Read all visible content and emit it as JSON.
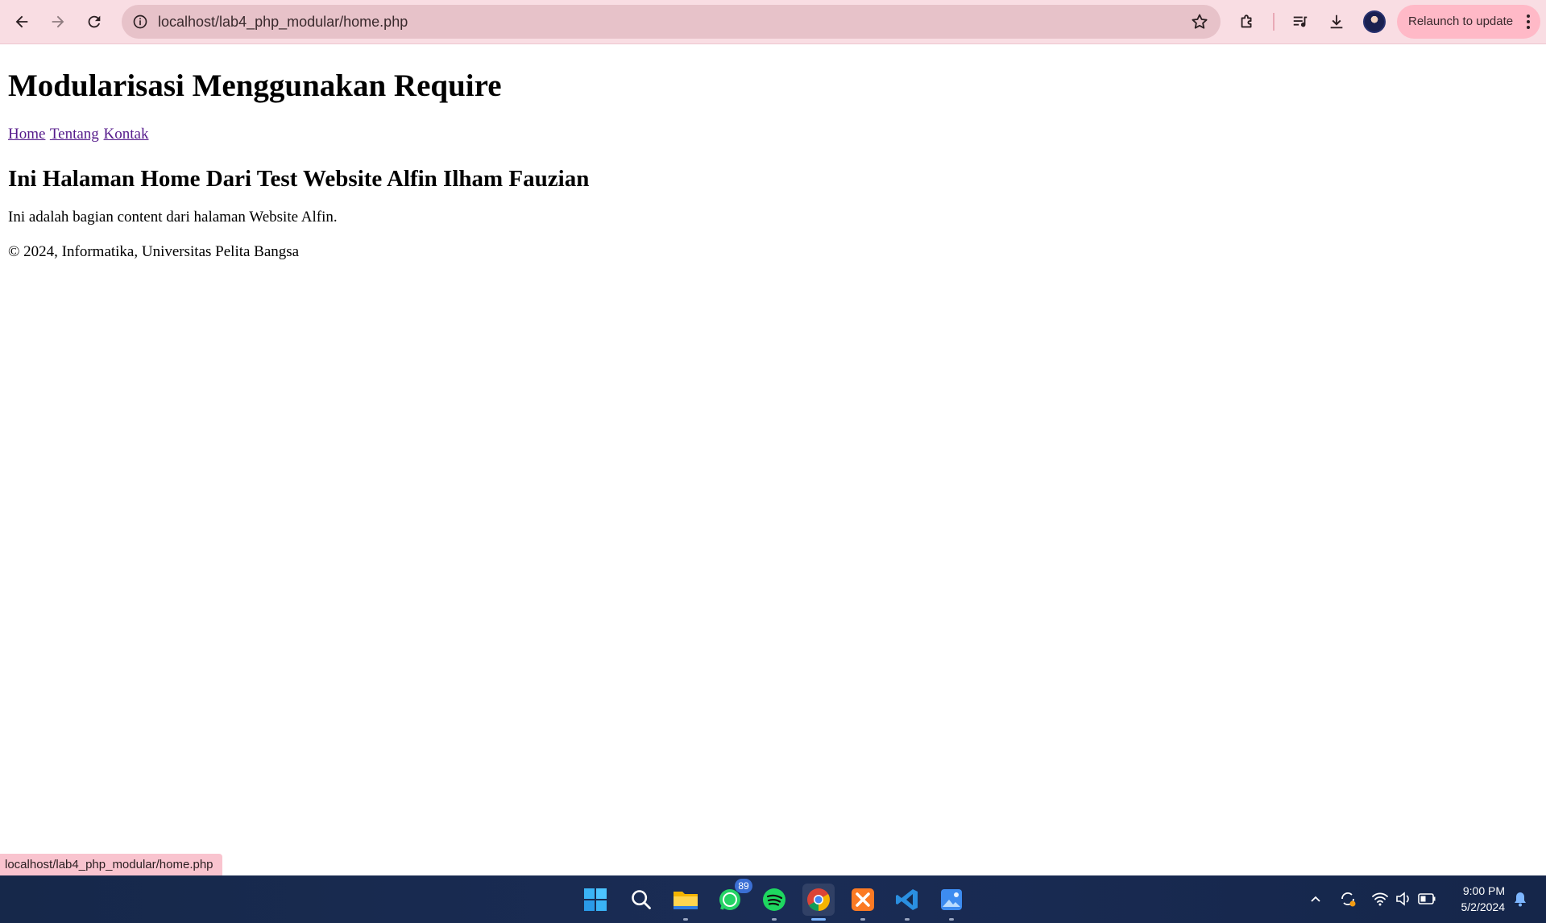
{
  "browser": {
    "url": "localhost/lab4_php_modular/home.php",
    "relaunch_label": "Relaunch to update",
    "status_url": "localhost/lab4_php_modular/home.php"
  },
  "page": {
    "title": "Modularisasi Menggunakan Require",
    "nav": [
      {
        "label": "Home"
      },
      {
        "label": "Tentang"
      },
      {
        "label": "Kontak"
      }
    ],
    "heading": "Ini Halaman Home Dari Test Website Alfin Ilham Fauzian",
    "content": "Ini adalah bagian content dari halaman Website Alfin.",
    "footer": "© 2024, Informatika, Universitas Pelita Bangsa"
  },
  "taskbar": {
    "apps": [
      {
        "name": "start-icon"
      },
      {
        "name": "search-icon"
      },
      {
        "name": "file-explorer-icon"
      },
      {
        "name": "whatsapp-icon",
        "badge": "89"
      },
      {
        "name": "spotify-icon"
      },
      {
        "name": "chrome-icon"
      },
      {
        "name": "xampp-icon"
      },
      {
        "name": "vscode-icon"
      },
      {
        "name": "photos-icon"
      }
    ],
    "time": "9:00 PM",
    "date": "5/2/2024"
  },
  "colors": {
    "toolbar_bg": "#f9dde3",
    "omnibox_bg": "#e7c2c9",
    "relaunch_bg": "#ffb9c7",
    "link_visited": "#551a8b",
    "taskbar_bg": "#1a2c55"
  }
}
